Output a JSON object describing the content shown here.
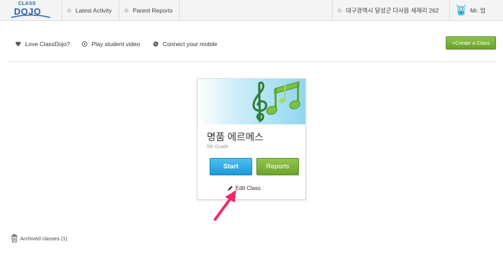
{
  "logo": {
    "small": "CLASS",
    "big": "DOJO"
  },
  "topnav": {
    "latest_activity": "Latest Activity",
    "parent_reports": "Parent Reports",
    "school": "대구광역시 달성군 다사읍 세재리 262",
    "user_name": "Mr. 엄"
  },
  "subbar": {
    "love": "Love ClassDojo?",
    "play_video": "Play student video",
    "connect_mobile": "Connect your mobile",
    "create_class": "+Create a Class"
  },
  "class_card": {
    "title": "명품 에르메스",
    "grade": "5th Grade",
    "start_label": "Start",
    "reports_label": "Reports",
    "edit_label": "Edit Class"
  },
  "archived": {
    "label": "Archived classes (1)"
  },
  "colors": {
    "accent_green": "#6aa12e",
    "accent_blue": "#1e9ad6",
    "annotation_arrow": "#f0286e",
    "logo_blue": "#2b64a3"
  },
  "icons": [
    "heart-icon",
    "play-icon",
    "globe-icon",
    "pencil-icon",
    "trash-icon",
    "monster-avatar-icon",
    "music-notes-icon"
  ]
}
